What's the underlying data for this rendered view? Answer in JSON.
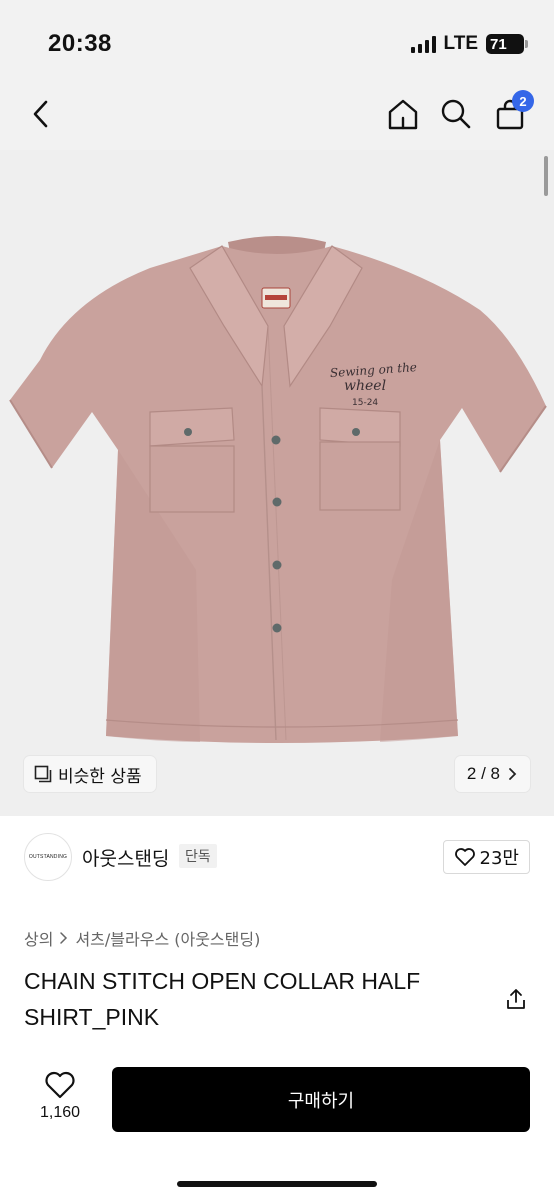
{
  "status_bar": {
    "time": "20:38",
    "network": "LTE",
    "battery": "71",
    "icons": [
      "signal-icon",
      "battery-icon"
    ]
  },
  "nav": {
    "icons": [
      "back-icon",
      "home-icon",
      "search-icon",
      "cart-icon"
    ],
    "cart_badge": "2"
  },
  "image": {
    "subject": "pink short-sleeve open collar shirt",
    "embroidery": [
      "Sewing on the",
      "wheel",
      "15-24"
    ],
    "similar_label": "비슷한 상품",
    "pager": "2 / 8",
    "colors": {
      "shirt": "#c9a29d",
      "background": "#efefef"
    }
  },
  "brand": {
    "logo_text": "OUTSTANDING",
    "name": "아웃스탠딩",
    "tag": "단독",
    "likes": "23만"
  },
  "breadcrumb": {
    "first": "상의",
    "second": "셔츠/블라우스 (아웃스탠딩)"
  },
  "product": {
    "title": "CHAIN STITCH OPEN COLLAR HALF SHIRT_PINK"
  },
  "bottom": {
    "wish_count": "1,160",
    "buy_label": "구매하기"
  }
}
